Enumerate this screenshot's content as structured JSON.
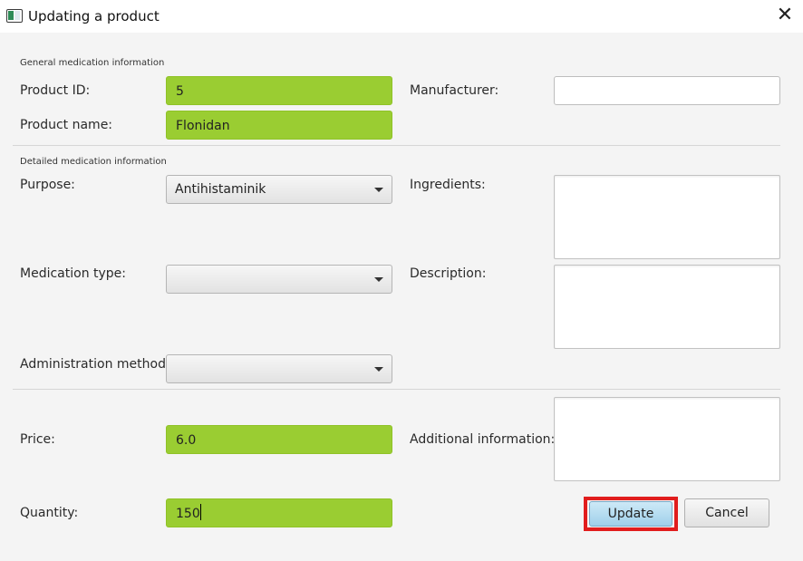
{
  "window": {
    "title": "Updating a product",
    "close_glyph": "✕"
  },
  "general": {
    "section_title": "General medication information",
    "product_id_label": "Product ID:",
    "product_id_value": "5",
    "product_name_label": "Product name:",
    "product_name_value": "Flonidan",
    "manufacturer_label": "Manufacturer:",
    "manufacturer_value": ""
  },
  "detailed": {
    "section_title": "Detailed medication information",
    "purpose_label": "Purpose:",
    "purpose_value": "Antihistaminik",
    "medication_type_label": "Medication type:",
    "medication_type_value": "",
    "administration_method_label": "Administration method:",
    "administration_method_value": "",
    "ingredients_label": "Ingredients:",
    "description_label": "Description:"
  },
  "pricing": {
    "price_label": "Price:",
    "price_value": "6.0",
    "quantity_label": "Quantity:",
    "quantity_value": "150",
    "additional_info_label": "Additional information:"
  },
  "buttons": {
    "update_label": "Update",
    "cancel_label": "Cancel"
  },
  "colors": {
    "valid_field": "#9acd32",
    "focus_highlight": "#e11d1d",
    "update_button": "#aad8ef"
  }
}
